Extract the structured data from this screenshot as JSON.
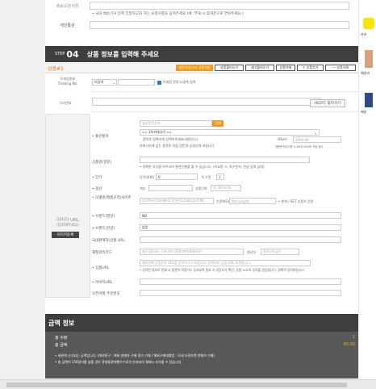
{
  "top": {
    "label1": "배송요청사항",
    "note": "• 국내 배송기사 분께 전달하고자 하는 요청사항을 남겨주세요.(예: 부재 시 휴대폰으로 연락주세요.)",
    "label2": "개인통관",
    "label2b": "개인통관"
  },
  "step": {
    "label": "STEP",
    "number": "04",
    "title": "상품 정보를 입력해 주세요"
  },
  "product": {
    "name": "상품#1",
    "buttons": {
      "tax": "영문가/신고가 공통적용",
      "load": "상품불러오기",
      "reload": "재고불러오기",
      "delete": "상품삭제",
      "add": "＋ 상품추가",
      "delete_all": "— 상품삭제"
    }
  },
  "tracking": {
    "label": "트래킹번호 Tracking No.",
    "select": "미입력",
    "checkbox_label": "트래킹 번호 나중에 입력"
  },
  "order_no": {
    "label": "오더번호",
    "hs_button": "HS코드 찾아가기"
  },
  "image": {
    "label": "이미지 URL",
    "sublabel": "(입력해주세요)",
    "button": "이미지등록"
  },
  "fields": {
    "category_label": "• 통관품목",
    "category_placeholder": "통관품목검색",
    "category_search": "검색",
    "category_select": "== 1차카테고리 ==",
    "category_hint1": "품목은 정확하게 선택하주세요(세관신고)",
    "category_hint2": "카테고리에 없는 품목은 직접 영문명 상세기재 바랍니다",
    "hscode_label": "HS코드",
    "hscode_placeholder": "0000.00",
    "hscode_hint": "영문명 작성기준 시 6자리 HS코드 작성 필수",
    "name_en_label": "상품명(영문)",
    "name_en_hint": "• 정확한 작성을 하주셔야 통관진행을 할 수 있습니다. (미요청 시, 특수문자, 한글 입력 금지)",
    "price_label": "• 단가",
    "price_currency": "단가(외화)",
    "price_value": "0",
    "qty_label": "X 수량",
    "qty_value": "1",
    "option_label": "• 옵션",
    "color_label": "색상",
    "size_label": "상품단위",
    "size_placeholder": "예: 8/FS/7호",
    "model_label": "• 모델명/제품규격/사이즈",
    "model_placeholder": "예:XPS4/1000Ml/4:30분/투2080L흰20ML",
    "weight_label": "순량(KG)",
    "weight_placeholder": "Net weight",
    "weight_hint": "• 한개 / SET 상품의 순량",
    "brand_en_label": "• 브랜드(영문)",
    "brand_en_value": "NO",
    "brand_kr_label": "• 브랜드(한글)",
    "brand_kr_value": "없음",
    "purchase_url_label": "국내판매처/상품 URL",
    "material_label": "재질관리코드",
    "material_placeholder": "표준상품코드 국제 코드(품명/판매/재질표준)",
    "origin_label": "원산지",
    "origin_placeholder": "한글입력금지",
    "product_url_label": "• 상품URL",
    "product_url_placeholder": "해외판매 상품문자 URL을 입력하시기 바랍니다. 판매처의 상품 URL 추천합니다.",
    "product_url_hint": "• 입력된 정보로 문제 시 통관이 어렵거나 상세내역 필요 시 담당자가 확인, 상품 URL의 입력을 권장합니다. 정확히 입력바랍니다.",
    "item_url_label": "• 이미지URL",
    "open_market_label": "오픈마켓 주문번호"
  },
  "price": {
    "title": "금액 정보",
    "total_qty_label": "총 수량",
    "total_qty_value": "1",
    "total_amount_label": "총 금액",
    "total_amount_value": "¥0.00",
    "note1": "• 세관에 신고되는 금액입니다. (해외직구 : 해외 판매자 구매 정가 기재 / 해외구매대행업 : 국내 오픈마켓 판매가 기재)",
    "note2": "• 총 금액이 150달러를 넘을 경우 관세통관대행수수료가 부과되어 결제시 추가될 수 있습니다."
  },
  "side": {
    "t1": "카카",
    "t2": "배송비",
    "t3": "배송"
  }
}
